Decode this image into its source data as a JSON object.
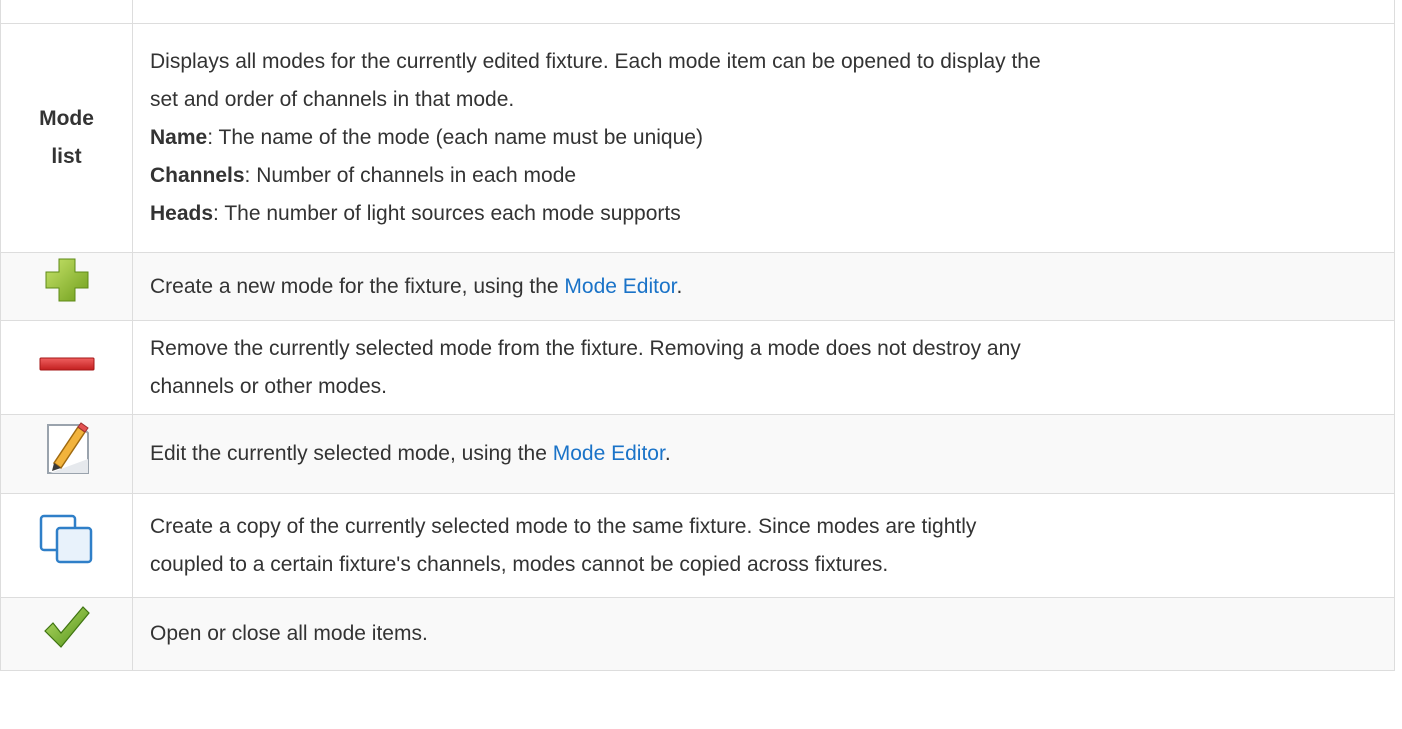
{
  "rows": {
    "mode_list": {
      "label_line1": "Mode",
      "label_line2": "list",
      "desc_line1": "Displays all modes for the currently edited fixture. Each mode item can be opened to display the",
      "desc_line2": "set and order of channels in that mode.",
      "fields": [
        {
          "term": "Name",
          "text": ": The name of the mode (each name must be unique)"
        },
        {
          "term": "Channels",
          "text": ": Number of channels in each mode"
        },
        {
          "term": "Heads",
          "text": ": The number of light sources each mode supports"
        }
      ]
    },
    "add": {
      "icon": "add-icon",
      "text_before": "Create a new mode for the fixture, using the ",
      "link": "Mode Editor",
      "text_after": "."
    },
    "remove": {
      "icon": "remove-icon",
      "line1": "Remove the currently selected mode from the fixture. Removing a mode does not destroy any",
      "line2": "channels or other modes."
    },
    "edit": {
      "icon": "edit-icon",
      "text_before": "Edit the currently selected mode, using the ",
      "link": "Mode Editor",
      "text_after": "."
    },
    "copy": {
      "icon": "copy-icon",
      "line1": "Create a copy of the currently selected mode to the same fixture. Since modes are tightly",
      "line2": "coupled to a certain fixture's channels, modes cannot be copied across fixtures."
    },
    "expand": {
      "icon": "check-icon",
      "text": "Open or close all mode items."
    }
  },
  "colors": {
    "link": "#1a73c8",
    "border": "#dddddd",
    "alt_row": "#f9f9f9"
  }
}
